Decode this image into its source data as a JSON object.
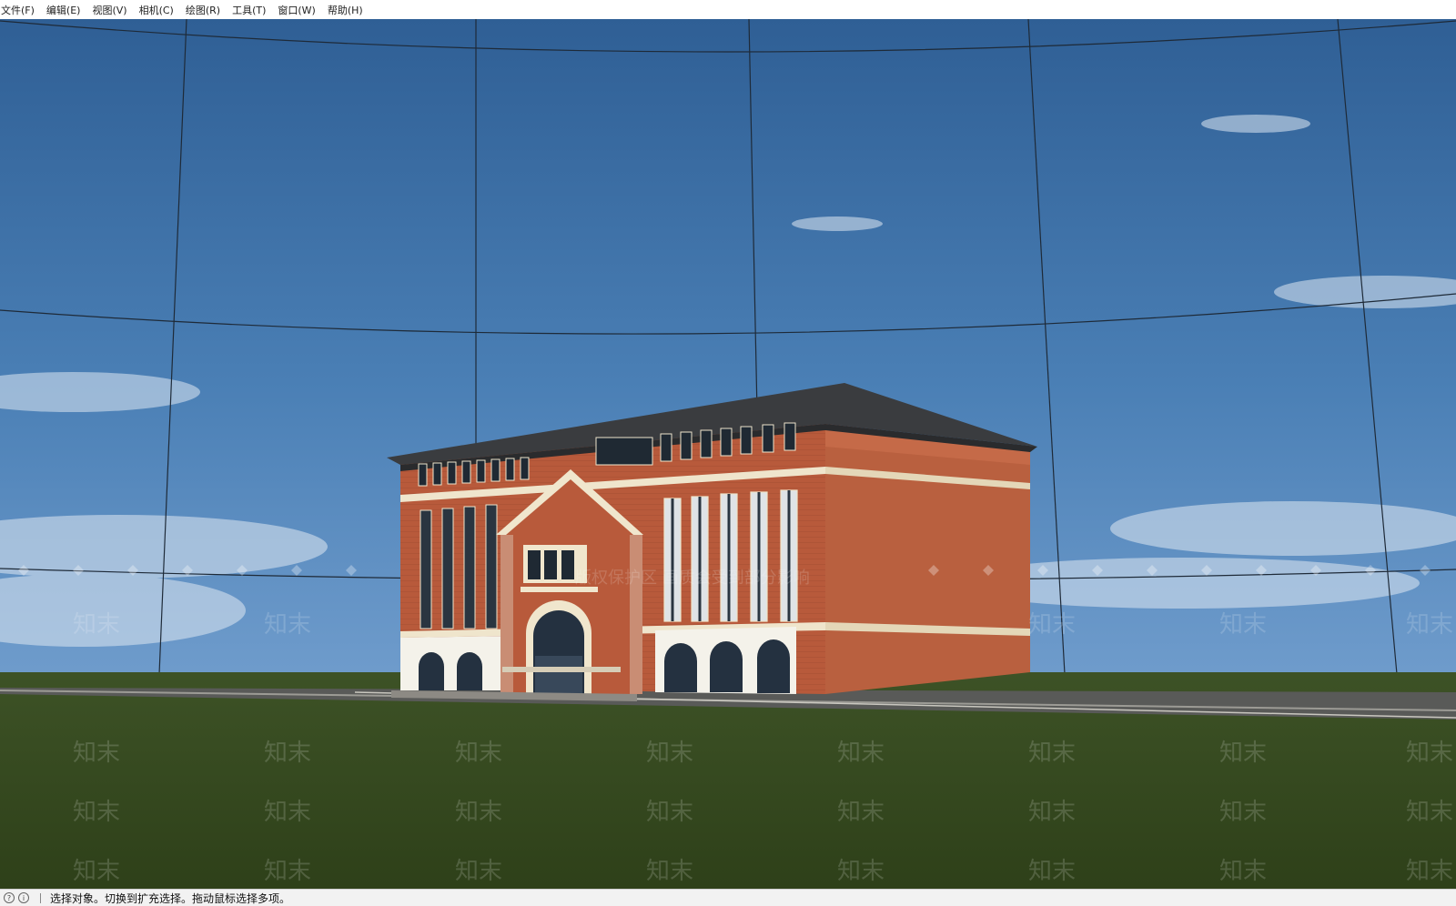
{
  "menu": {
    "items": [
      "文件(F)",
      "编辑(E)",
      "视图(V)",
      "相机(C)",
      "绘图(R)",
      "工具(T)",
      "窗口(W)",
      "帮助(H)"
    ]
  },
  "viewport": {
    "watermark_text": "知末",
    "protection_text": "版权保护区  画质会受到部分影响",
    "colors": {
      "sky": "#3f72a6",
      "ground": "#34481f",
      "brick": "#b5583a",
      "roof": "#3a3c3f",
      "trim": "#efe5cc"
    }
  },
  "status": {
    "icons": [
      "help-icon",
      "info-icon"
    ],
    "text": "选择对象。切换到扩充选择。拖动鼠标选择多项。"
  }
}
